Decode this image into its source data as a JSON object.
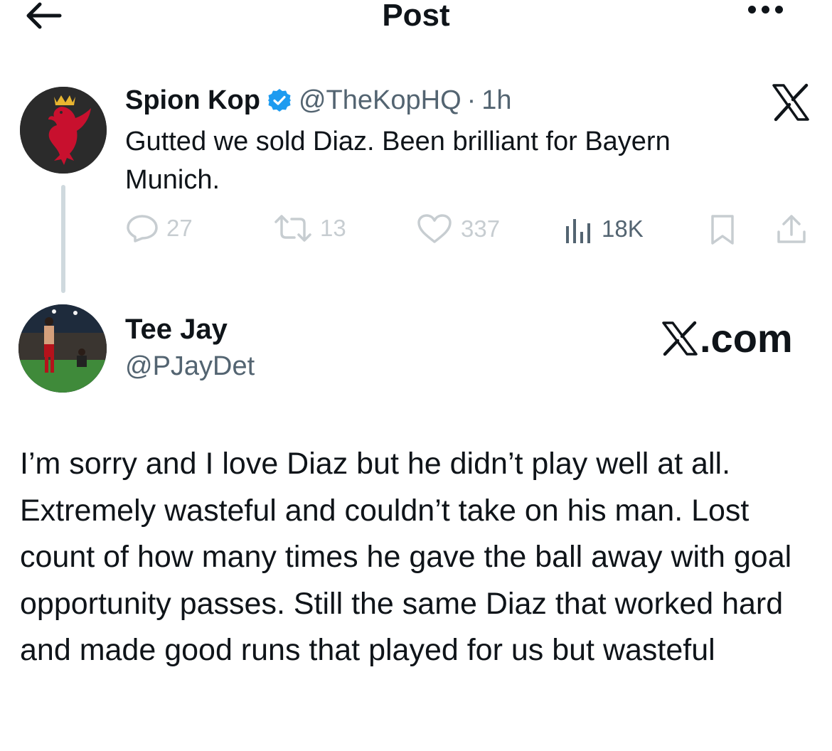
{
  "header": {
    "title": "Post",
    "back_icon": "arrow-left-icon",
    "more_icon": "more-horizontal-icon"
  },
  "parent_post": {
    "display_name": "Spion Kop",
    "handle": "@TheKopHQ",
    "separator": "·",
    "time": "1h",
    "text": "Gutted we sold Diaz. Been brilliant for Bayern Munich.",
    "verified_color": "#1d9bf0",
    "actions": {
      "replies": "27",
      "reposts": "13",
      "likes": "337",
      "views": "18K"
    }
  },
  "reply_post": {
    "display_name": "Tee Jay",
    "handle": "@PJayDet",
    "watermark": ".com",
    "text": "I’m sorry and I love Diaz but he didn’t play well at all. Extremely wasteful and couldn’t take on his man. Lost count of how many times he gave the ball away with goal opportunity passes. Still the same Diaz that worked hard and made good runs that played for us but wasteful"
  },
  "colors": {
    "text_primary": "#0f1419",
    "text_secondary": "#536471",
    "action_faded": "#c7cdd1",
    "thread_line": "#cfd9de",
    "accent": "#1d9bf0",
    "liverbird_red": "#c8102e"
  }
}
